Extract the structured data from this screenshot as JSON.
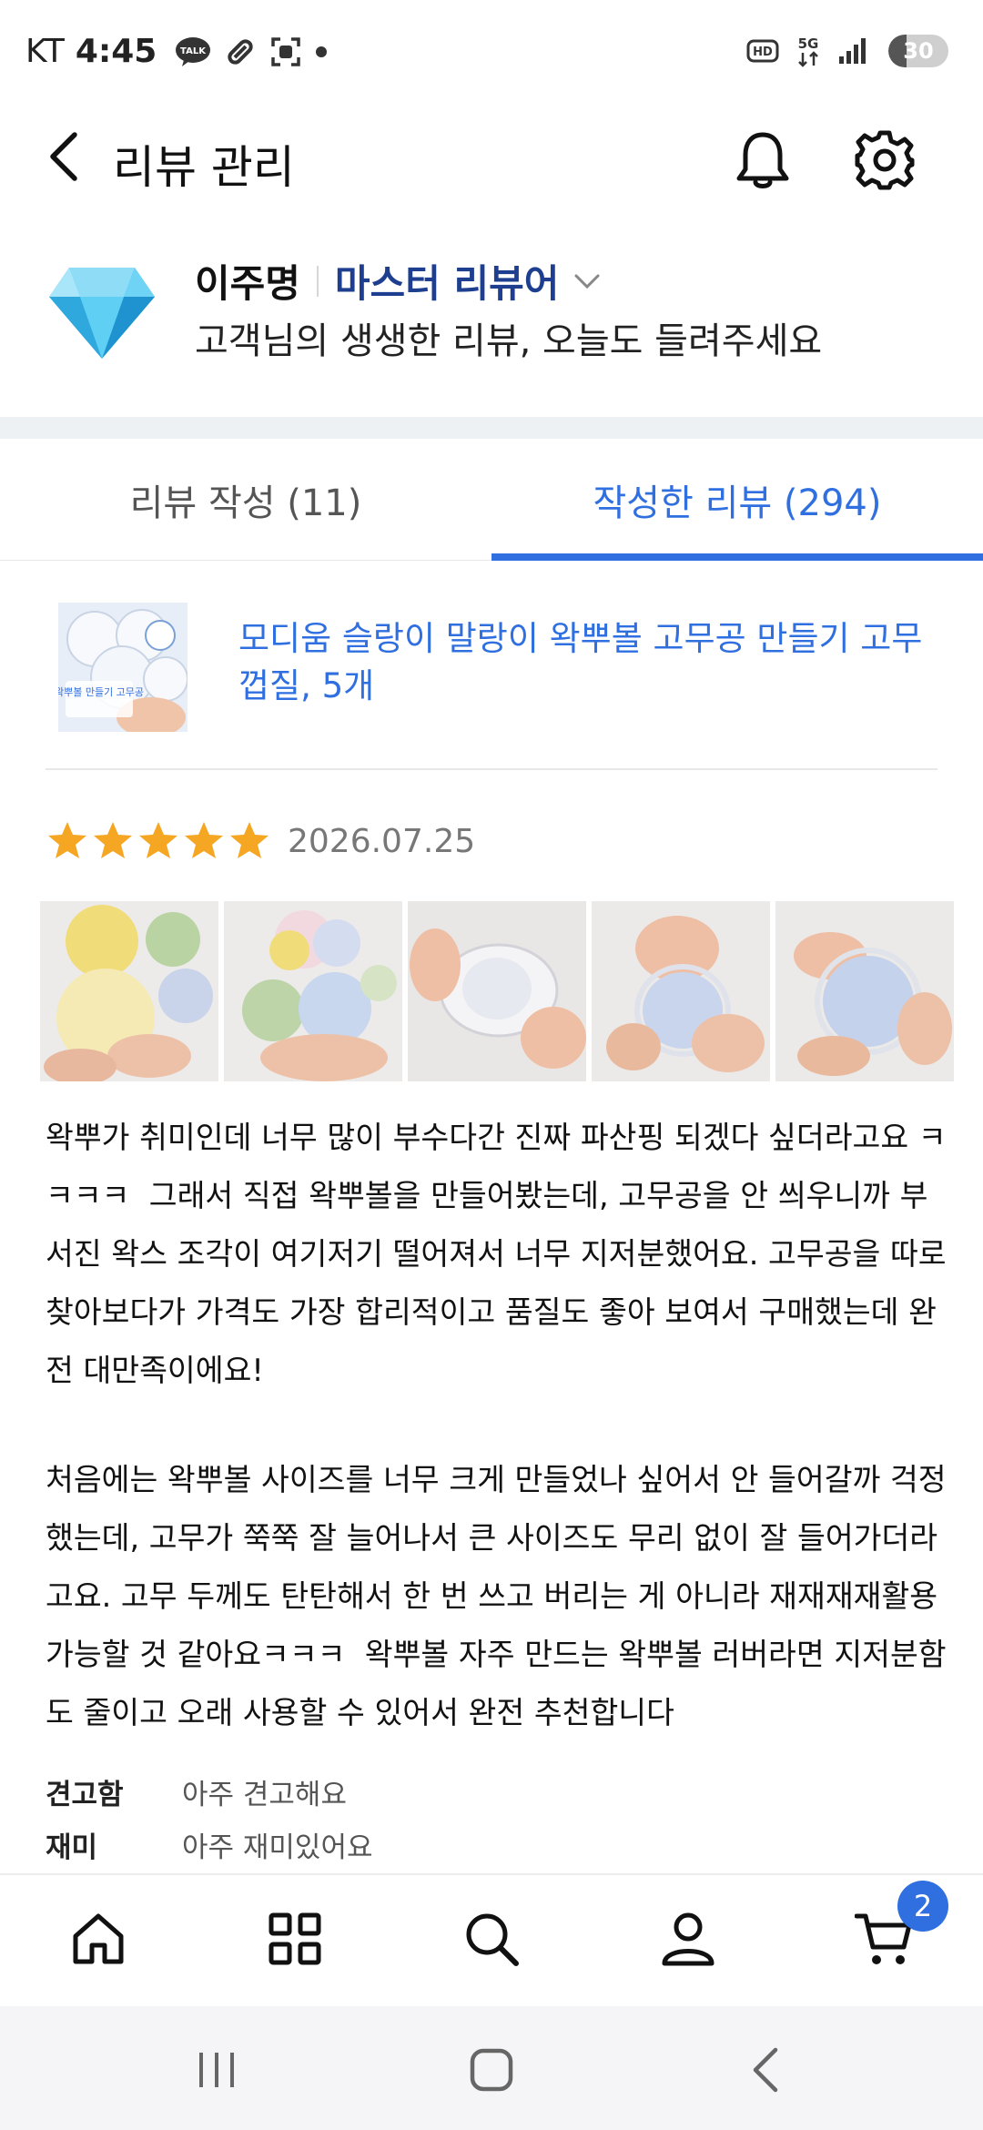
{
  "status_bar": {
    "carrier": "KT",
    "time": "4:45",
    "talk_badge": "TALK",
    "network": "5G",
    "hd_label": "HD",
    "battery": "30",
    "battery_level": 0.3
  },
  "header": {
    "title": "리뷰 관리"
  },
  "profile": {
    "name": "이주명",
    "grade": "마스터 리뷰어",
    "subtitle": "고객님의 생생한 리뷰, 오늘도 들려주세요"
  },
  "tabs": [
    {
      "label": "리뷰 작성 (11)",
      "active": false
    },
    {
      "label": "작성한 리뷰 (294)",
      "active": true
    }
  ],
  "review": {
    "product_name": "모디움 슬랑이 말랑이 왁뿌볼 고무공 만들기 고무 껍질, 5개",
    "product_thumb_text": "왁뿌볼 만들기 고무공",
    "rating": 5,
    "date": "2026.07.25",
    "photo_count_visible": 5,
    "body_p1": "왁뿌가 취미인데 너무 많이 부수다간 진짜 파산핑 되겠다 싶더라고요 ㅋㅋㅋㅋ  그래서 직접 왁뿌볼을 만들어봤는데, 고무공을 안 씌우니까 부서진 왁스 조각이 여기저기 떨어져서 너무 지저분했어요. 고무공을 따로 찾아보다가 가격도 가장 합리적이고 품질도 좋아 보여서 구매했는데 완전 대만족이에요!",
    "body_p2": "처음에는 왁뿌볼 사이즈를 너무 크게 만들었나 싶어서 안 들어갈까 걱정했는데, 고무가 쭉쭉 잘 늘어나서 큰 사이즈도 무리 없이 잘 들어가더라고요. 고무 두께도 탄탄해서 한 번 쓰고 버리는 게 아니라 재재재재활용 가능할 것 같아요ㅋㅋㅋ  왁뿌볼 자주 만드는 왁뿌볼 러버라면 지저분함도 줄이고 오래 사용할 수 있어서 완전 추천합니다",
    "attributes": [
      {
        "label": "견고함",
        "value": "아주 견고해요"
      },
      {
        "label": "재미",
        "value": "아주 재미있어요"
      }
    ]
  },
  "bottom_nav": {
    "items": [
      "home-icon",
      "category-grid-icon",
      "search-icon",
      "profile-icon",
      "cart-icon"
    ],
    "cart_badge": "2"
  },
  "colors": {
    "accent": "#2f6fe0",
    "grade": "#1e3f8f",
    "star": "#f5a623",
    "divider": "#eef1f4"
  }
}
